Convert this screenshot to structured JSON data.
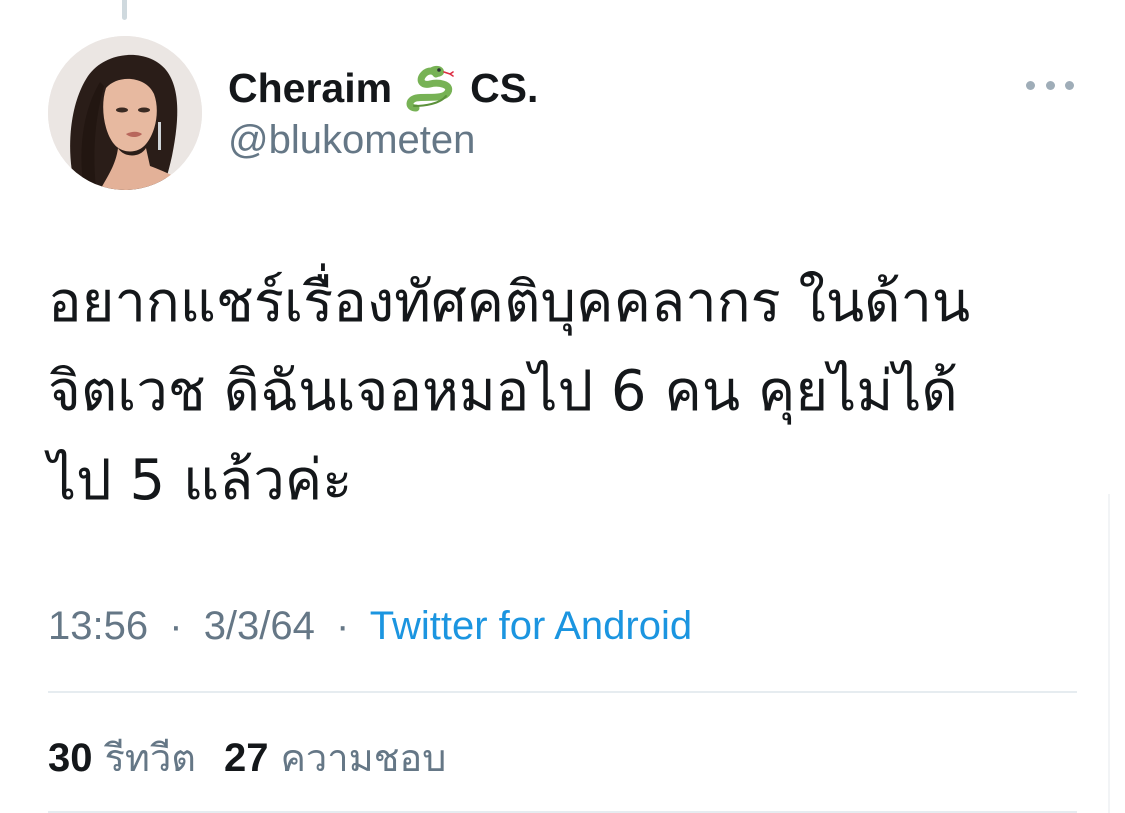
{
  "user": {
    "display_name": "Cheraim",
    "name_emoji": "snake-emoji",
    "name_suffix": "CS.",
    "handle": "@blukometen"
  },
  "tweet": {
    "lines": [
      "อยากแชร์เรื่องทัศคติบุคคลากร ในด้าน",
      "จิตเวช ดิฉันเจอหมอไป 6 คน คุยไม่ได้",
      "ไป 5 แล้วค่ะ"
    ]
  },
  "meta": {
    "time": "13:56",
    "separator": "·",
    "date": "3/3/64",
    "source": "Twitter for Android"
  },
  "stats": {
    "retweets_count": "30",
    "retweets_label": "รีทวีต",
    "likes_count": "27",
    "likes_label": "ความชอบ"
  },
  "colors": {
    "text_primary": "#14171a",
    "text_secondary": "#657786",
    "link": "#1b95e0",
    "divider": "#e6ecf0"
  },
  "icons": {
    "more": "more-horizontal-icon"
  }
}
